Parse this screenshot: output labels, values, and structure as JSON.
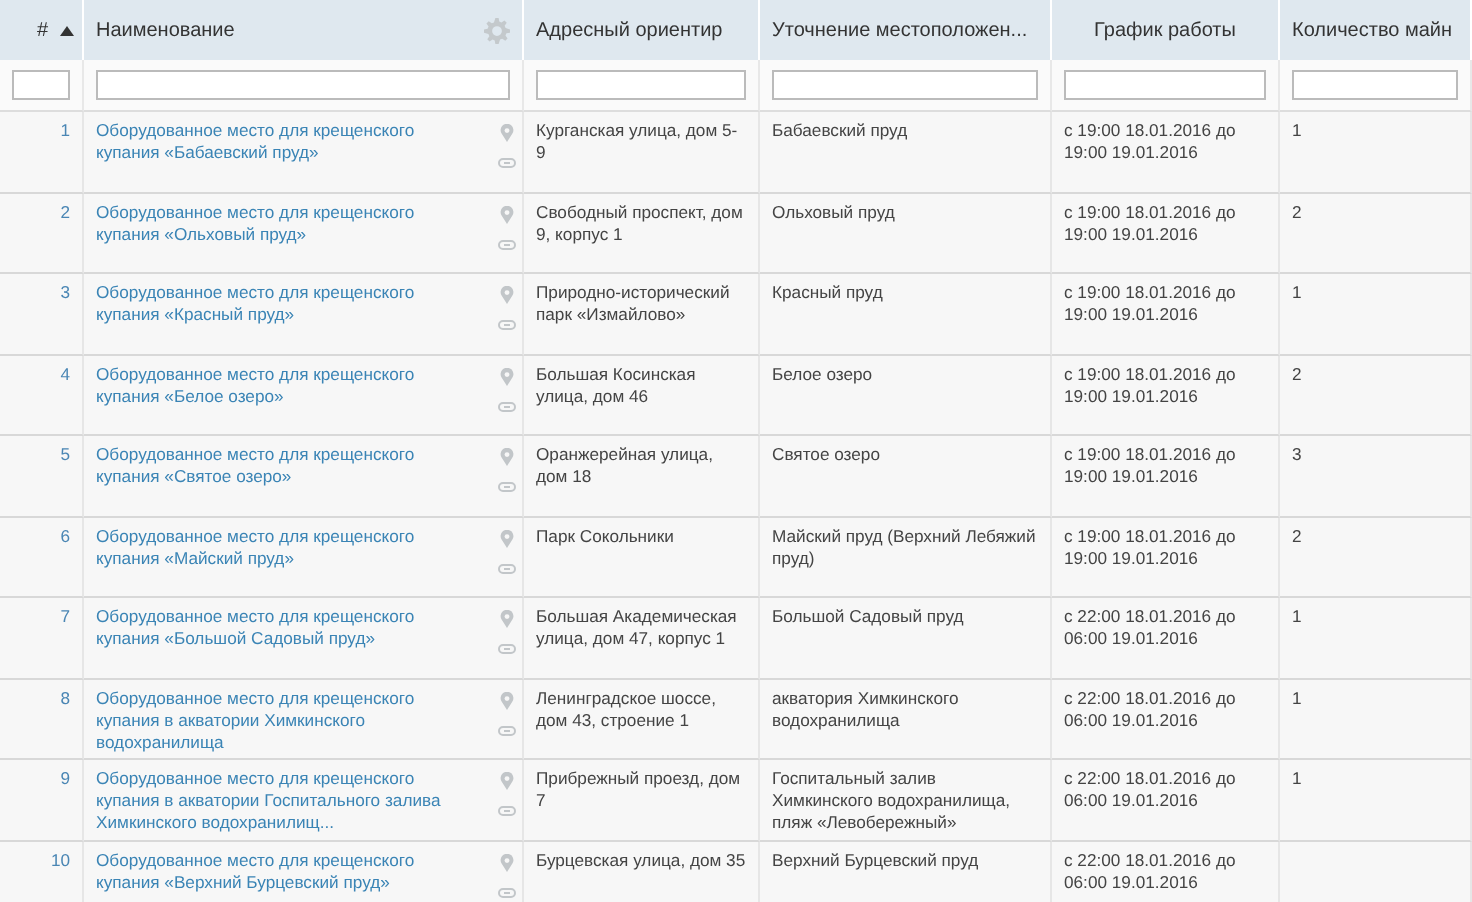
{
  "table": {
    "columns": [
      {
        "label": "#",
        "sorted": true
      },
      {
        "label": "Наименование",
        "sorted": false
      },
      {
        "label": "Адресный ориентир",
        "sorted": false
      },
      {
        "label": "Уточнение местоположен...",
        "sorted": false
      },
      {
        "label": "График работы",
        "sorted": false
      },
      {
        "label": "Количество майн",
        "sorted": false
      }
    ],
    "rows": [
      {
        "number": "1",
        "name": "Оборудованное место для крещенского купания «Бабаевский пруд»",
        "address": "Курганская улица, дом 5-9",
        "location": "Бабаевский пруд",
        "schedule": "с 19:00 18.01.2016 до 19:00 19.01.2016",
        "count": "1"
      },
      {
        "number": "2",
        "name": "Оборудованное место для крещенского купания «Ольховый пруд»",
        "address": "Свободный проспект, дом 9, корпус 1",
        "location": "Ольховый пруд",
        "schedule": "с 19:00 18.01.2016 до 19:00 19.01.2016",
        "count": "2"
      },
      {
        "number": "3",
        "name": "Оборудованное место для крещенского купания «Красный пруд»",
        "address": "Природно-исторический парк «Измайлово»",
        "location": "Красный пруд",
        "schedule": "с 19:00 18.01.2016 до 19:00 19.01.2016",
        "count": "1"
      },
      {
        "number": "4",
        "name": "Оборудованное место для крещенского купания «Белое озеро»",
        "address": "Большая Косинская улица, дом 46",
        "location": "Белое озеро",
        "schedule": "с 19:00 18.01.2016 до 19:00 19.01.2016",
        "count": "2"
      },
      {
        "number": "5",
        "name": "Оборудованное место для крещенского купания «Святое озеро»",
        "address": "Оранжерейная улица, дом 18",
        "location": "Святое озеро",
        "schedule": "с 19:00 18.01.2016 до 19:00 19.01.2016",
        "count": "3"
      },
      {
        "number": "6",
        "name": "Оборудованное место для крещенского купания «Майский пруд»",
        "address": "Парк Сокольники",
        "location": "Майский пруд (Верхний Лебяжий пруд)",
        "schedule": "с 19:00 18.01.2016 до 19:00 19.01.2016",
        "count": "2"
      },
      {
        "number": "7",
        "name": "Оборудованное место для крещенского купания «Большой Садовый пруд»",
        "address": "Большая Академическая улица, дом 47, корпус 1",
        "location": "Большой Садовый пруд",
        "schedule": "с 22:00 18.01.2016 до 06:00 19.01.2016",
        "count": "1"
      },
      {
        "number": "8",
        "name": "Оборудованное место для крещенского купания в акватории Химкинского водохранилища",
        "address": "Ленинградское шоссе, дом 43, строение 1",
        "location": "акватория Химкинского водохранилища",
        "schedule": "с 22:00 18.01.2016 до 06:00 19.01.2016",
        "count": "1"
      },
      {
        "number": "9",
        "name": "Оборудованное место для крещенского купания в акватории Госпитального залива Химкинского водохранилищ...",
        "address": "Прибрежный проезд, дом 7",
        "location": "Госпитальный залив Химкинского водохранилища, пляж «Левобережный»",
        "schedule": "с 22:00 18.01.2016 до 06:00 19.01.2016",
        "count": "1"
      },
      {
        "number": "10",
        "name": "Оборудованное место для крещенского купания «Верхний Бурцевский пруд»",
        "address": "Бурцевская улица, дом 35",
        "location": "Верхний Бурцевский пруд",
        "schedule": "с 22:00 18.01.2016 до 06:00 19.01.2016"
      }
    ]
  }
}
